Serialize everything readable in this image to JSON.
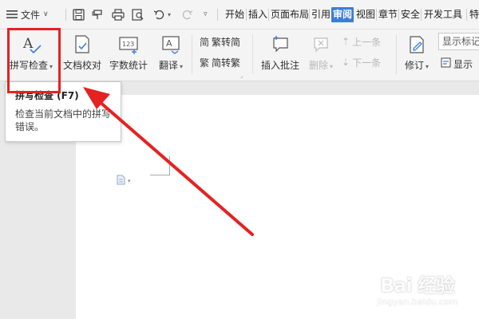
{
  "menubar": {
    "file_label": "文件",
    "tabs": [
      {
        "label": "开始",
        "active": false
      },
      {
        "label": "插入",
        "active": false
      },
      {
        "label": "页面布局",
        "active": false
      },
      {
        "label": "引用",
        "active": false
      },
      {
        "label": "审阅",
        "active": true
      },
      {
        "label": "视图",
        "active": false
      },
      {
        "label": "章节",
        "active": false
      },
      {
        "label": "安全",
        "active": false
      },
      {
        "label": "开发工具",
        "active": false
      },
      {
        "label": "特",
        "active": false
      }
    ],
    "active_color": "#3b7ddd"
  },
  "ribbon": {
    "spell_check": "拼写检查",
    "doc_proof": "文档校对",
    "word_count": "字数统计",
    "translate": "翻译",
    "trad_to_simp": "繁转简",
    "simp_to_trad": "简转繁",
    "insert_comment": "插入批注",
    "delete": "删除",
    "prev": "上一条",
    "next": "下一条",
    "track_changes": "修订",
    "display_markup": "显示标记",
    "display": "显示",
    "icons": {
      "spell_check": "spell-check-icon",
      "doc_proof": "document-check-icon",
      "word_count": "word-count-icon",
      "translate": "translate-icon"
    }
  },
  "tooltip": {
    "title": "拼写检查 (F7)",
    "description": "检查当前文档中的拼写错误。"
  },
  "annotation_color": "#e42222",
  "watermark": {
    "text": "Bai 经验",
    "url": "jingyan.baidu.com"
  }
}
